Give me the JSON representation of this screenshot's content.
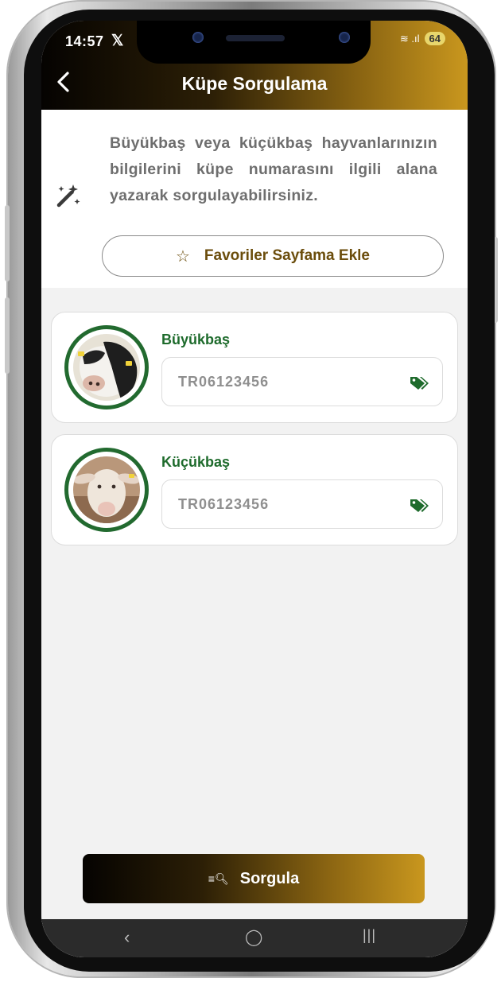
{
  "status_bar": {
    "time": "14:57",
    "x_logo": "𝕏",
    "signal": "≋ .ıl",
    "battery": "64"
  },
  "header": {
    "title": "Küpe Sorgulama"
  },
  "info": {
    "text": "Büyükbaş veya küçükbaş hayvanlarınızın bilgilerini küpe numarasını ilgili alana yazarak sorgulayabilirsiniz.",
    "favorite_button_label": "Favoriler Sayfama Ekle"
  },
  "cards": [
    {
      "label": "Büyükbaş",
      "placeholder": "TR06123456"
    },
    {
      "label": "Küçükbaş",
      "placeholder": "TR06123456"
    }
  ],
  "query_button": {
    "label": "Sorgula"
  },
  "navbar": {
    "back": "‹",
    "home": "◯",
    "recents": "|||"
  },
  "colors": {
    "accent_gold": "#c9971e",
    "accent_green": "#1e6b2c",
    "fav_text": "#6b4d0c"
  }
}
